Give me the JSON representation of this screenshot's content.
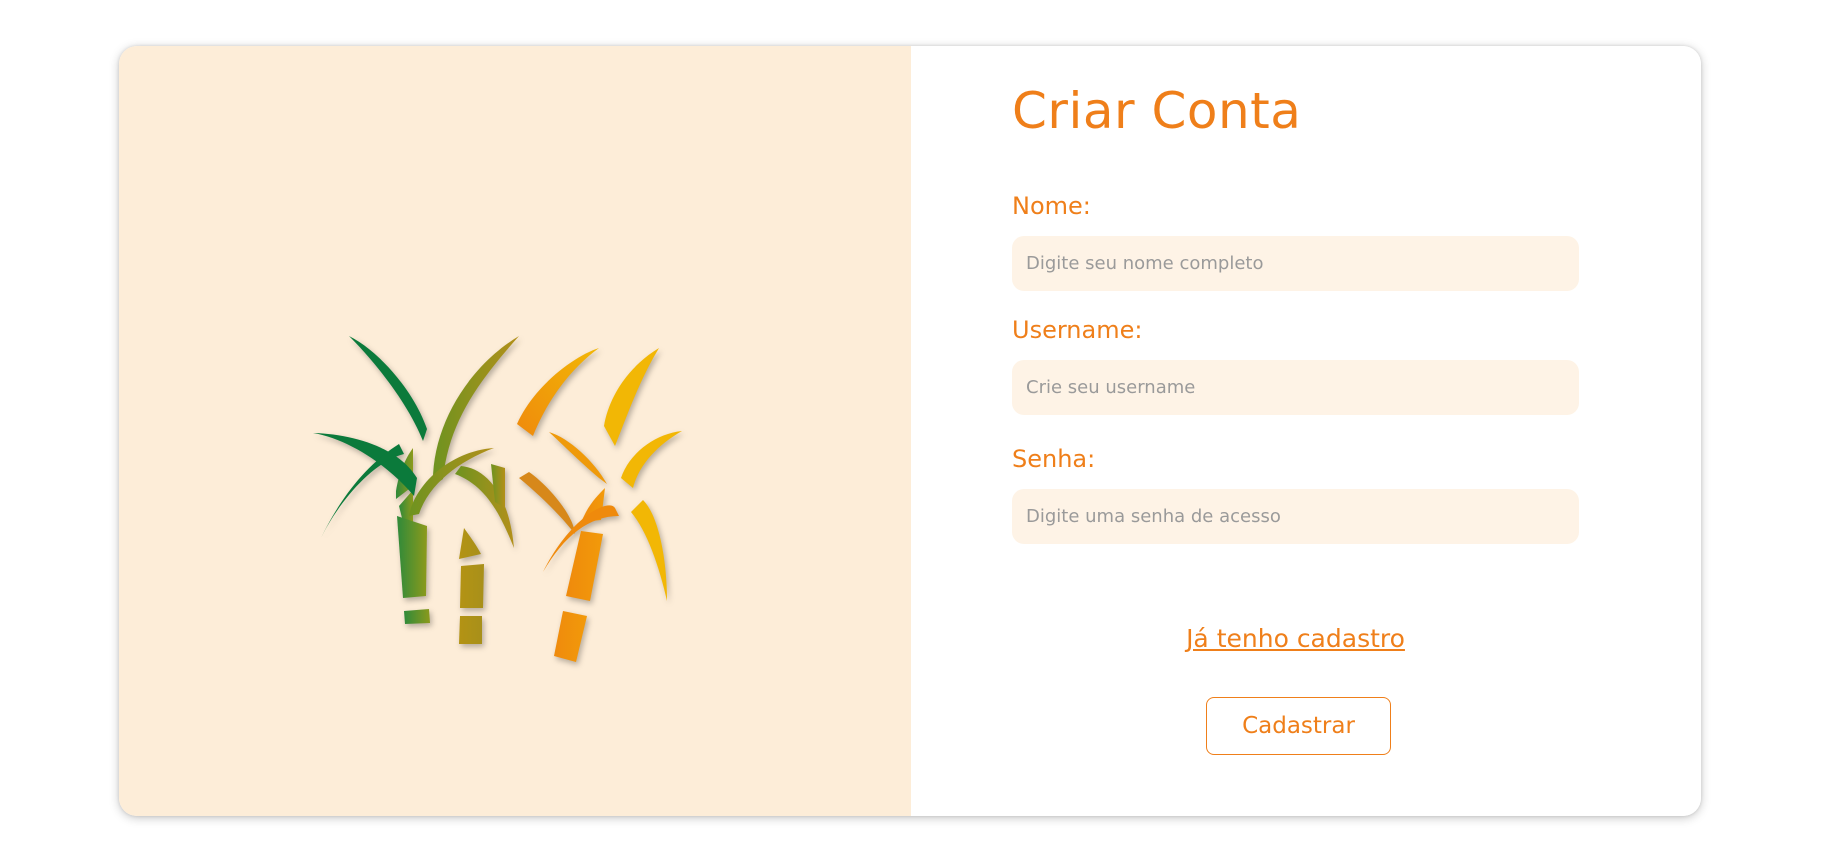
{
  "brand": {
    "logo_icon": "sugarcane-icon",
    "colors": [
      "#0b7a3b",
      "#8c9a1c",
      "#ef8a0c",
      "#f2b705"
    ]
  },
  "form": {
    "title": "Criar Conta",
    "fields": [
      {
        "label": "Nome:",
        "placeholder": "Digite seu nome completo",
        "value": ""
      },
      {
        "label": "Username:",
        "placeholder": "Crie seu username",
        "value": ""
      },
      {
        "label": "Senha:",
        "placeholder": "Digite uma senha de acesso",
        "value": ""
      }
    ],
    "login_link": "Já tenho cadastro",
    "submit_label": "Cadastrar"
  },
  "theme": {
    "accent": "#ef7f1a",
    "panel_bg": "#fdedd8",
    "input_bg": "#fef3e6"
  }
}
